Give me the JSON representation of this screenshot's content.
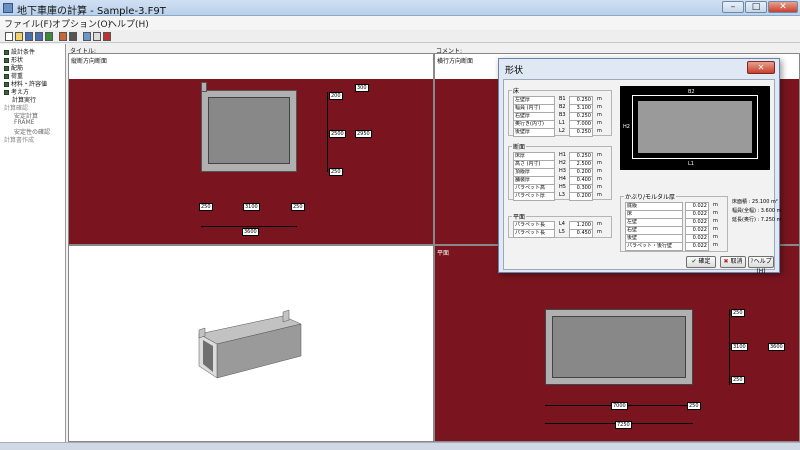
{
  "window": {
    "title": "地下車庫の計算 - Sample-3.F9T"
  },
  "menu": [
    "ファイル(F)",
    "オプション(O)",
    "ヘルプ(H)"
  ],
  "tree": {
    "items": [
      {
        "label": "設計条件",
        "level": 0,
        "active": true
      },
      {
        "label": "形状",
        "level": 0,
        "active": true
      },
      {
        "label": "配筋",
        "level": 0,
        "active": true
      },
      {
        "label": "荷重",
        "level": 0,
        "active": true
      },
      {
        "label": "材料・許容値",
        "level": 0,
        "active": true
      },
      {
        "label": "考え方",
        "level": 0,
        "active": true
      },
      {
        "label": "計算実行",
        "level": 0,
        "active": false
      },
      {
        "label": "計算確認",
        "level": 0,
        "active": false
      },
      {
        "label": "安定計算",
        "level": 1,
        "active": false
      },
      {
        "label": "FRAME",
        "level": 1,
        "active": false
      },
      {
        "label": "安定性の確認",
        "level": 1,
        "active": false
      },
      {
        "label": "計算書作成",
        "level": 0,
        "active": false
      }
    ]
  },
  "panes": {
    "title_label": "タイトル:",
    "comment_label": "コメント:",
    "left_view": "縦断方向断面",
    "right_view": "横行方向断面",
    "plan_label": "平面"
  },
  "left_drawing": {
    "dims_right": [
      "200",
      "2500",
      "250",
      "2950",
      "300"
    ],
    "dims_bottom": [
      "250",
      "3100",
      "250"
    ],
    "total": "3600"
  },
  "right_drawing": {
    "dims_right": [
      "250",
      "3100",
      "250",
      "3600"
    ],
    "dims_bottom": [
      "7000",
      "250"
    ],
    "total": "7250"
  },
  "dialog": {
    "title": "形状",
    "close": "✕",
    "floor_group": "床",
    "floor_rows": [
      {
        "label": "左壁厚",
        "sym": "B1",
        "value": "0.250",
        "unit": "m"
      },
      {
        "label": "幅員 (内寸)",
        "sym": "B2",
        "value": "3.100",
        "unit": "m"
      },
      {
        "label": "右壁厚",
        "sym": "B3",
        "value": "0.250",
        "unit": "m"
      },
      {
        "label": "奥行き(内寸)",
        "sym": "L1",
        "value": "7.000",
        "unit": "m"
      },
      {
        "label": "後壁厚",
        "sym": "L2",
        "value": "0.250",
        "unit": "m"
      }
    ],
    "section_group": "断面",
    "section_rows": [
      {
        "label": "床厚",
        "sym": "H1",
        "value": "0.250",
        "unit": "m"
      },
      {
        "label": "高さ (内寸)",
        "sym": "H2",
        "value": "2.500",
        "unit": "m"
      },
      {
        "label": "頂版厚",
        "sym": "H3",
        "value": "0.200",
        "unit": "m"
      },
      {
        "label": "舗装厚",
        "sym": "H4",
        "value": "0.400",
        "unit": "m"
      },
      {
        "label": "パラペット高",
        "sym": "H5",
        "value": "0.300",
        "unit": "m"
      },
      {
        "label": "パラペット厚",
        "sym": "L3",
        "value": "0.200",
        "unit": "m"
      }
    ],
    "plan_group": "平面",
    "plan_rows": [
      {
        "label": "パラペット長",
        "sym": "L4",
        "value": "1.200",
        "unit": "m"
      },
      {
        "label": "パラペット長",
        "sym": "L5",
        "value": "0.450",
        "unit": "m"
      }
    ],
    "cover_group": "かぶり/モルタル厚",
    "cover_rows": [
      {
        "label": "底版",
        "value": "0.022",
        "unit": "m"
      },
      {
        "label": "床",
        "value": "0.022",
        "unit": "m"
      },
      {
        "label": "左壁",
        "value": "0.022",
        "unit": "m"
      },
      {
        "label": "右壁",
        "value": "0.022",
        "unit": "m"
      },
      {
        "label": "後壁",
        "value": "0.022",
        "unit": "m"
      },
      {
        "label": "パラペット・後行壁",
        "value": "0.022",
        "unit": "m"
      }
    ],
    "summary": [
      {
        "label": "床面積",
        "value": ": 25.100 m²"
      },
      {
        "label": "幅員(全幅)",
        "value": ": 3.600 m"
      },
      {
        "label": "延長(奥行)",
        "value": ": 7.250 m"
      }
    ],
    "preview_labels": [
      "B2",
      "L1",
      "H2"
    ],
    "buttons": {
      "ok": "確定",
      "cancel": "取消",
      "help": "ヘルプ(H)"
    }
  },
  "colors": {
    "accent": "#7a1520",
    "frame": "#8e8e8e",
    "concrete": "#a3a3a3"
  }
}
